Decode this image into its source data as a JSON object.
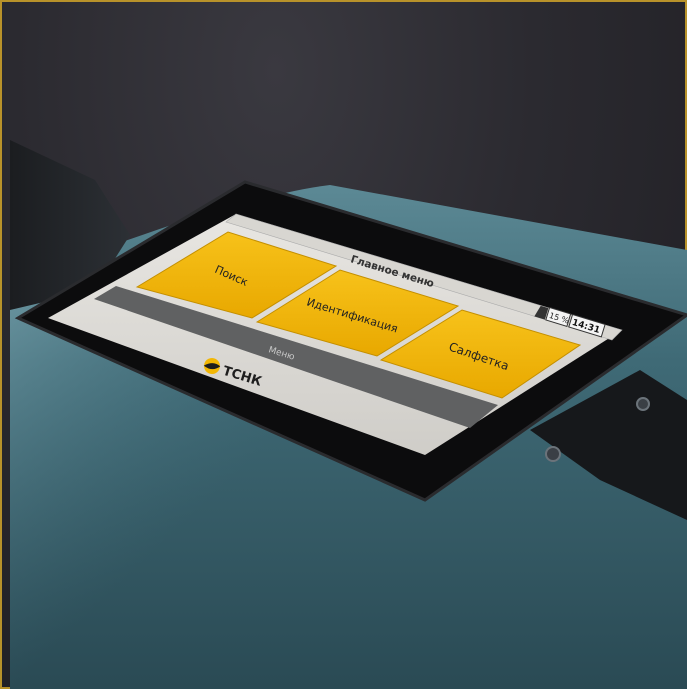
{
  "screen": {
    "title": "Главное меню",
    "battery_percent": "15 %",
    "time": "14:31",
    "tiles": [
      {
        "label": "Поиск"
      },
      {
        "label": "Идентификация"
      },
      {
        "label": "Салфетка"
      }
    ],
    "menu_bar_label": "Меню",
    "brand": "ТСНК"
  },
  "colors": {
    "tile_yellow": "#f2b705",
    "device_body": "#3c6470",
    "screen_bezel": "#0c0c0d",
    "gold_border": "#b8922a"
  }
}
